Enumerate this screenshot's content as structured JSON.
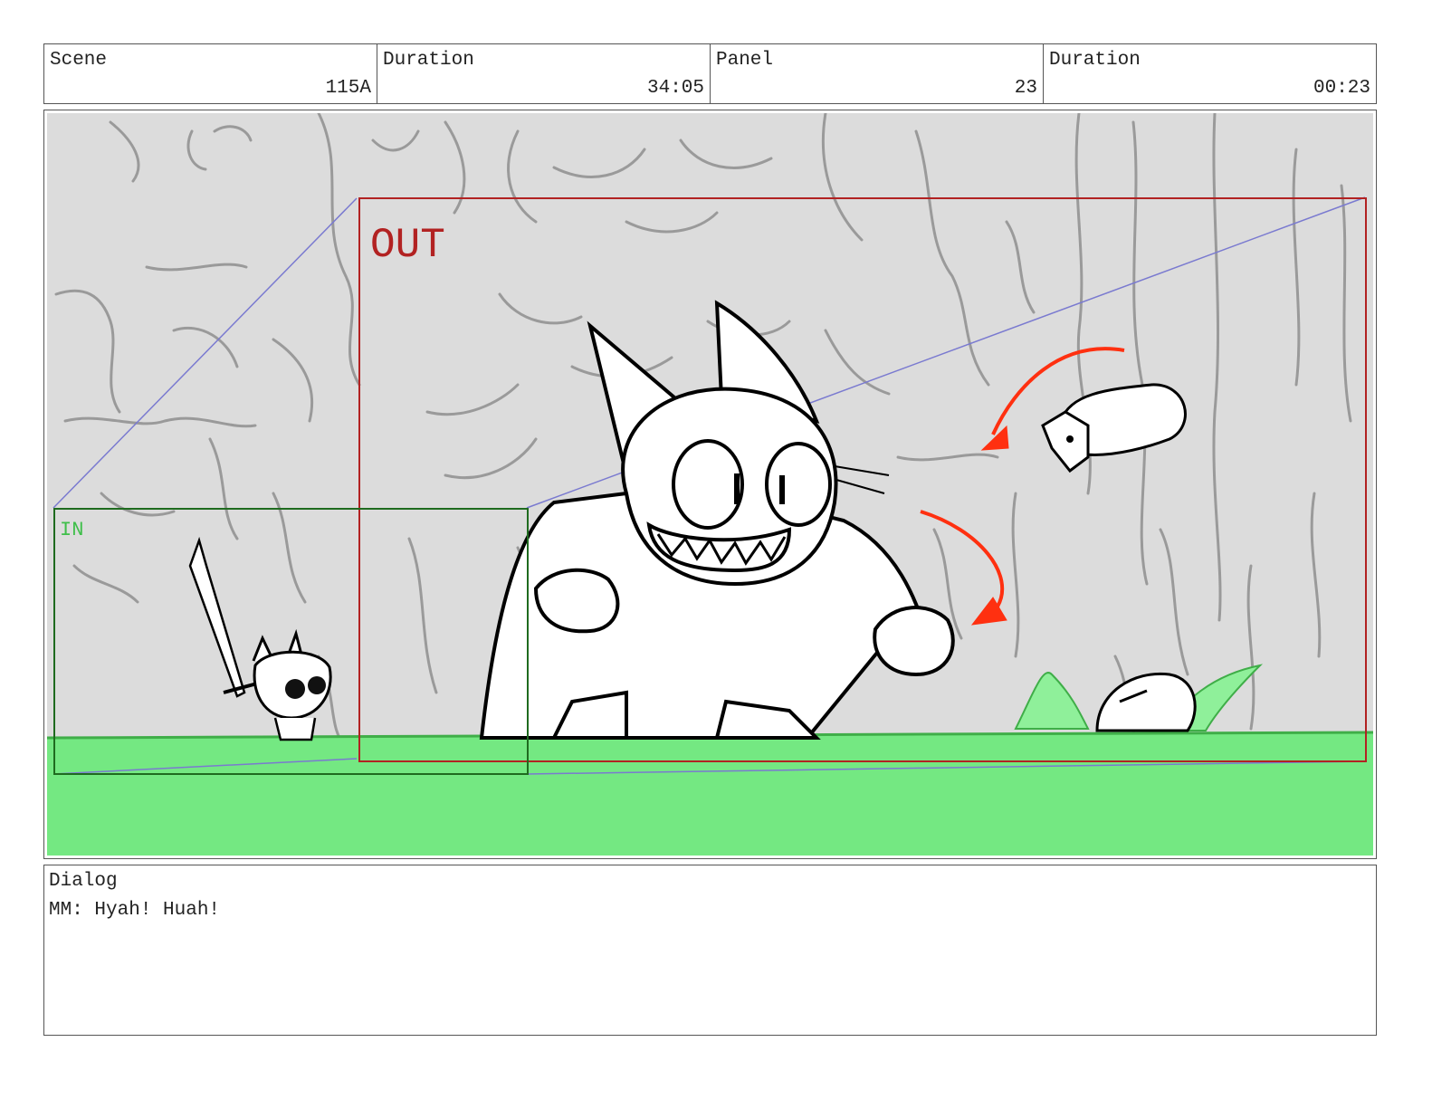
{
  "header": {
    "scene_label": "Scene",
    "scene_value": "115A",
    "duration_label": "Duration",
    "duration_value": "34:05",
    "panel_label": "Panel",
    "panel_value": "23",
    "panel_duration_label": "Duration",
    "panel_duration_value": "00:23"
  },
  "frame": {
    "out_label": "OUT",
    "in_label": "IN",
    "colors": {
      "background": "#dcdcdc",
      "ground": "#74e882",
      "out_frame": "#b22222",
      "in_frame": "#1f6b1f",
      "motion_arrow": "#ff3010",
      "camera_path": "#7a7ad0",
      "splash": "#8ff09a"
    }
  },
  "dialog": {
    "label": "Dialog",
    "text": "MM: Hyah! Huah!"
  }
}
